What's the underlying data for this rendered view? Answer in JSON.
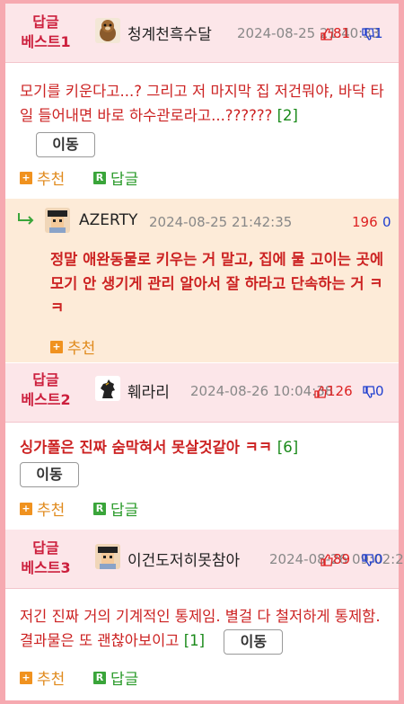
{
  "labels": {
    "move": "이동",
    "recommend": "추천",
    "reply": "답글",
    "plus": "+",
    "r": "R"
  },
  "comments": [
    {
      "rank": "답글\n베스트1",
      "nickname": "청계천흑수달",
      "date": "2024-08-25 21:40:33",
      "up": "81",
      "down": "1",
      "text": "모기를 키운다고...? 그리고 저 마지막 집 저건뭐야, 바닥 타일 들어내면 바로 하수관로라고...?????? ",
      "count": "[2]"
    },
    {
      "nickname": "AZERTY",
      "date": "2024-08-25 21:42:35",
      "up": "196",
      "down": "0",
      "text": "정말 애완동물로 키우는 거 말고, 집에 물 고이는 곳에 모기 안 생기게 관리 알아서 잘 하라고 단속하는 거 ㅋㅋ"
    },
    {
      "rank": "답글\n베스트2",
      "nickname": "훼라리",
      "date": "2024-08-26 10:04:38",
      "up": "126",
      "down": "0",
      "text": "싱가폴은 진짜 숨막혀서 못살것같아 ㅋㅋ ",
      "count": "[6]"
    },
    {
      "rank": "답글\n베스트3",
      "nickname": "이건도저히못참아",
      "date": "2024-08-26 09:02:22",
      "up": "89",
      "down": "0",
      "text": "저긴 진짜 거의 기계적인 통제임. 별걸 다 철저하게 통제함. 결과물은 또 괜찮아보이고 ",
      "count": "[1]"
    }
  ],
  "colors": {
    "accent": "#cc1f3d",
    "border": "#f6a9b0",
    "header_bg": "#fce6e9",
    "reply_bg": "#fdebd8"
  }
}
